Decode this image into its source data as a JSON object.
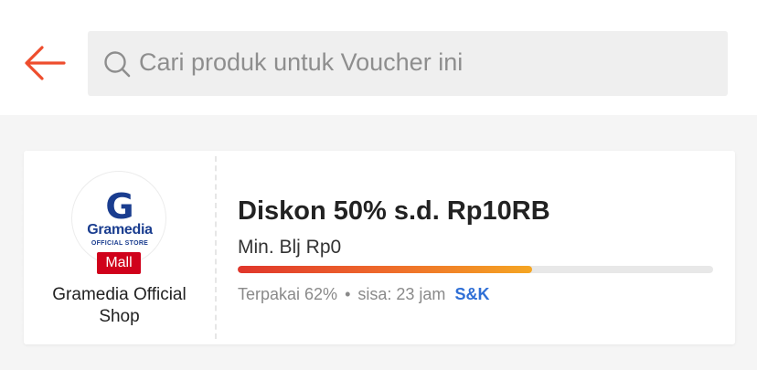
{
  "header": {
    "back_icon": "arrow-left-icon",
    "search": {
      "icon": "search-icon",
      "placeholder": "Cari produk untuk Voucher ini"
    }
  },
  "voucher": {
    "shop": {
      "logo_letter": "G",
      "logo_name": "Gramedia",
      "logo_sub": "OFFICIAL STORE",
      "badge": "Mall",
      "name": "Gramedia Official Shop"
    },
    "title": "Diskon 50% s.d. Rp10RB",
    "min_spend": "Min. Blj Rp0",
    "progress_percent": 62,
    "used_text": "Terpakai 62%",
    "separator": "•",
    "remaining_text": "sisa: 23 jam",
    "terms_link": "S&K"
  },
  "colors": {
    "accent": "#ee4d2d",
    "mall_badge": "#d0011b",
    "link": "#2f6fd6",
    "logo_blue": "#1a3d8f"
  }
}
